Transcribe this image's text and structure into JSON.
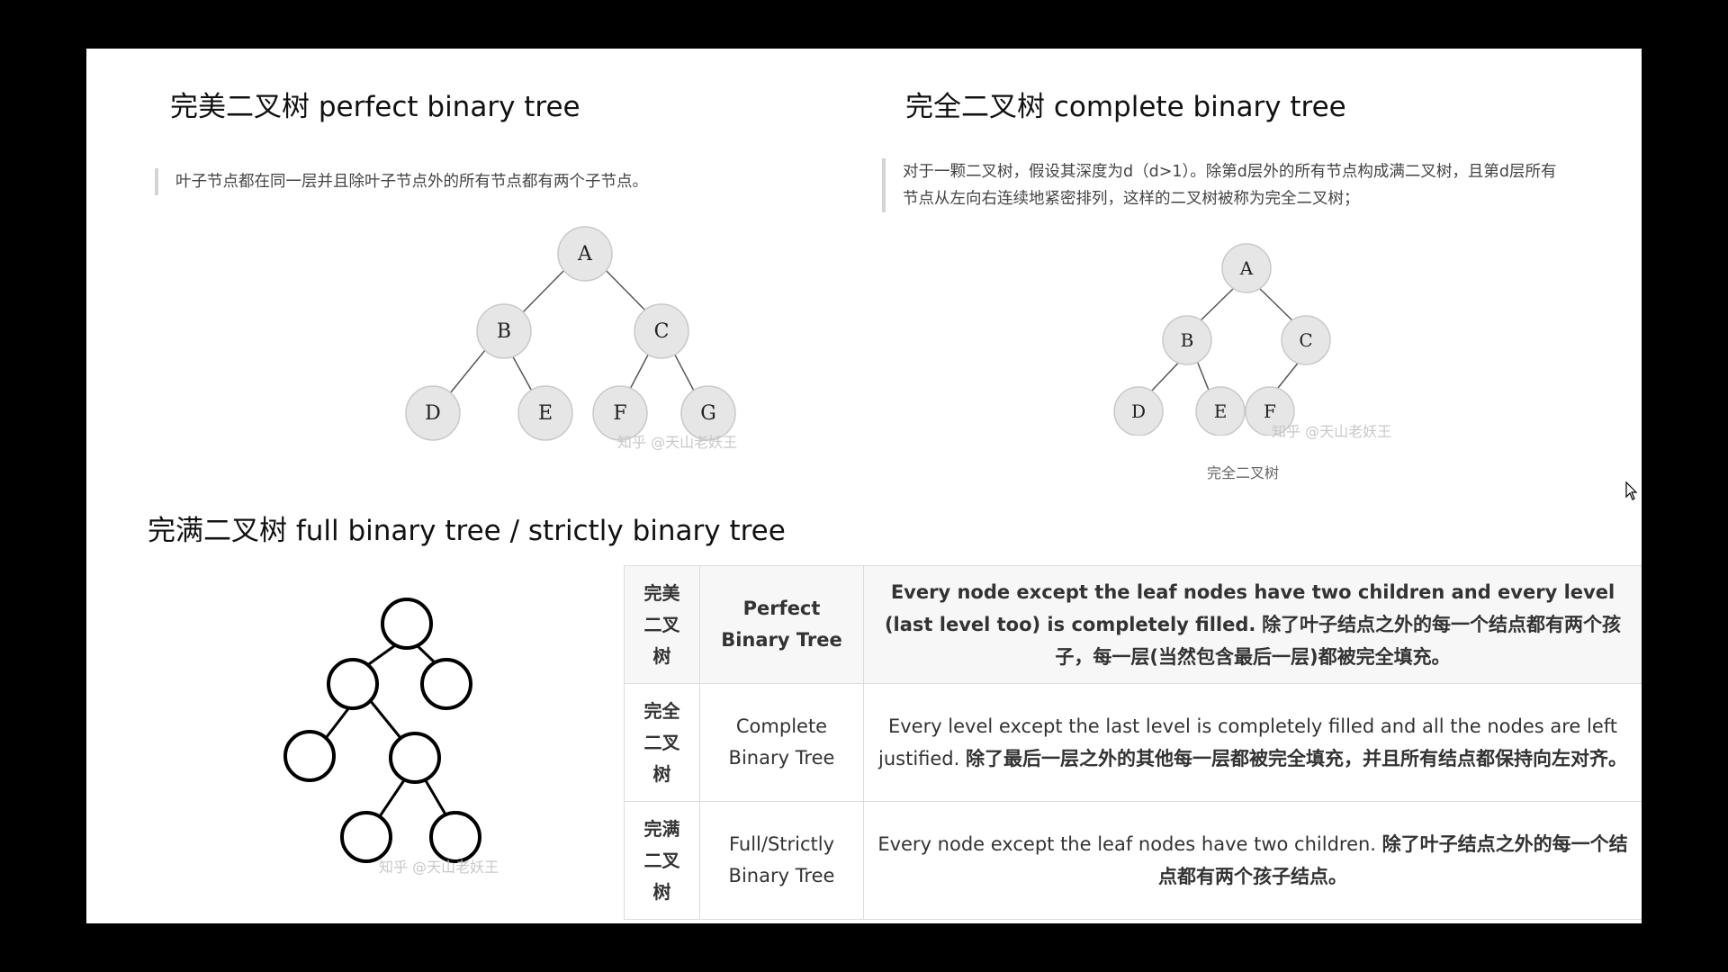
{
  "perfect": {
    "title": "完美二叉树 perfect binary tree",
    "quote": "叶子节点都在同一层并且除叶子节点外的所有节点都有两个子节点。",
    "nodes": [
      "A",
      "B",
      "C",
      "D",
      "E",
      "F",
      "G"
    ],
    "watermark": "知乎 @天山老妖王"
  },
  "complete": {
    "title": "完全二叉树  complete binary tree",
    "quote_line1": "对于一颗二叉树，假设其深度为d（d>1）。除第d层外的所有节点构成满二叉树，且第d层所有",
    "quote_line2": "节点从左向右连续地紧密排列，这样的二叉树被称为完全二叉树；",
    "nodes": [
      "A",
      "B",
      "C",
      "D",
      "E",
      "F"
    ],
    "watermark": "知乎 @天山老妖王",
    "caption": "完全二叉树"
  },
  "full": {
    "title": "完满二叉树 full binary tree / strictly binary tree",
    "watermark": "知乎 @天山老妖王"
  },
  "table": {
    "rows": [
      {
        "cn": [
          "完美",
          "二叉",
          "树"
        ],
        "name": "Perfect Binary Tree",
        "desc_en": "Every node except the leaf nodes have two children and every level (last level too) is completely filled.",
        "desc_cn": "除了叶子结点之外的每一个结点都有两个孩子，每一层(当然包含最后一层)都被完全填充。"
      },
      {
        "cn": [
          "完全",
          "二叉",
          "树"
        ],
        "name": "Complete Binary Tree",
        "desc_en": "Every level except the last level is completely filled and all the nodes are left justified.",
        "desc_cn": "除了最后一层之外的其他每一层都被完全填充，并且所有结点都保持向左对齐。"
      },
      {
        "cn": [
          "完满",
          "二叉",
          "树"
        ],
        "name": "Full/Strictly Binary Tree",
        "desc_en": "Every node except the leaf nodes have two children.",
        "desc_cn": "除了叶子结点之外的每一个结点都有两个孩子结点。"
      }
    ]
  },
  "colors": {
    "node_fill": "#e6e6e6",
    "node_stroke": "#c9c9c9",
    "edge": "#555555",
    "header_row_bg": "#f7f7f7"
  }
}
